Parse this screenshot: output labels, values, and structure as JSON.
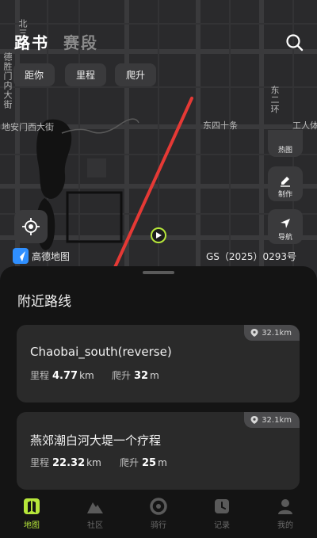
{
  "header": {
    "tab_route": "路书",
    "tab_race": "赛段"
  },
  "filters": [
    "距你",
    "里程",
    "爬升"
  ],
  "map": {
    "labels": {
      "north": "北三环",
      "deshengmen": "德胜门内大街",
      "dianmen": "地安门西大街",
      "east_ring": "东二环",
      "dongsi": "东四十条",
      "gongti": "工人体"
    },
    "tools": {
      "heatmap": "热图",
      "make": "制作",
      "navigate": "导航"
    },
    "logo_text": "高德地图",
    "license": "GS（2025）0293号"
  },
  "sheet": {
    "title": "附近路线",
    "mileage_label": "里程",
    "climb_label": "爬升",
    "routes": [
      {
        "distance_badge": "32.1km",
        "name": "Chaobai_south(reverse)",
        "mileage": "4.77",
        "mileage_unit": "km",
        "climb": "32",
        "climb_unit": "m"
      },
      {
        "distance_badge": "32.1km",
        "name": "燕郊潮白河大堤一个疗程",
        "mileage": "22.32",
        "mileage_unit": "km",
        "climb": "25",
        "climb_unit": "m"
      }
    ]
  },
  "nav": [
    {
      "label": "地图",
      "active": true
    },
    {
      "label": "社区",
      "active": false
    },
    {
      "label": "骑行",
      "active": false
    },
    {
      "label": "记录",
      "active": false
    },
    {
      "label": "我的",
      "active": false
    }
  ],
  "colors": {
    "accent": "#b6e63a",
    "arrow": "#e53935",
    "card": "#2a2a2a",
    "map_bg": "#2a2a2c"
  }
}
